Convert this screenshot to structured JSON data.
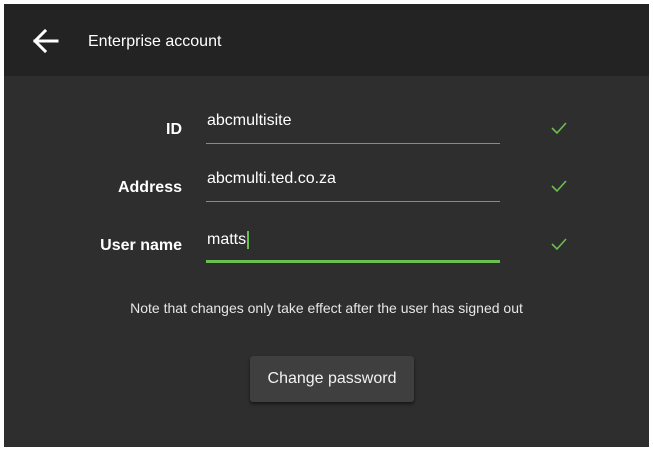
{
  "header": {
    "title": "Enterprise account",
    "back_icon": "arrow-left-icon"
  },
  "form": {
    "fields": [
      {
        "label": "ID",
        "value": "abcmultisite",
        "valid": true
      },
      {
        "label": "Address",
        "value": "abcmulti.ted.co.za",
        "valid": true
      },
      {
        "label": "User name",
        "value": "matts",
        "valid": true,
        "focused": true
      }
    ],
    "note": "Note that changes only take effect after the user has signed out",
    "change_password_label": "Change password"
  },
  "colors": {
    "background": "#2e2e2e",
    "appbar": "#232323",
    "accent": "#6bbf4e",
    "text": "#ffffff"
  }
}
